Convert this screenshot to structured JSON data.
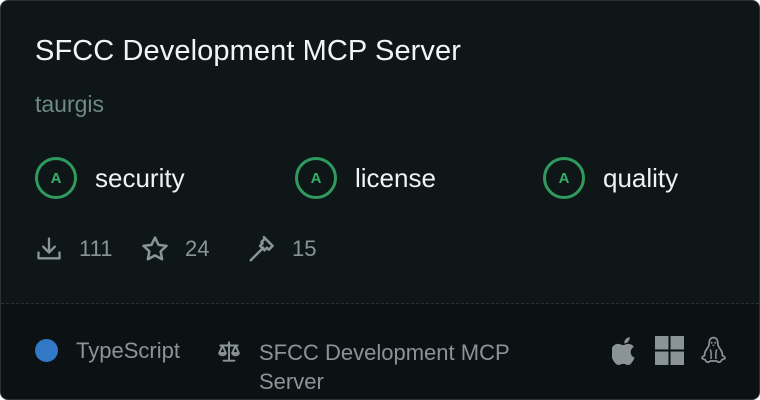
{
  "server": {
    "title": "SFCC Development MCP Server",
    "author": "taurgis"
  },
  "badges": [
    {
      "grade": "A",
      "label": "security"
    },
    {
      "grade": "A",
      "label": "license"
    },
    {
      "grade": "A",
      "label": "quality"
    }
  ],
  "stats": {
    "downloads": "111",
    "stars": "24",
    "tools": "15"
  },
  "footer": {
    "language": "TypeScript",
    "language_color": "#3178c6",
    "license": "SFCC Development MCP Server"
  },
  "icons": {
    "downloads": "download-icon",
    "stars": "star-icon",
    "tools": "hammer-icon",
    "license": "scale-icon",
    "platforms": [
      "apple-icon",
      "windows-icon",
      "linux-icon"
    ]
  },
  "colors": {
    "grade_accent": "#2e9a5d",
    "card_background": "#0f1618"
  }
}
